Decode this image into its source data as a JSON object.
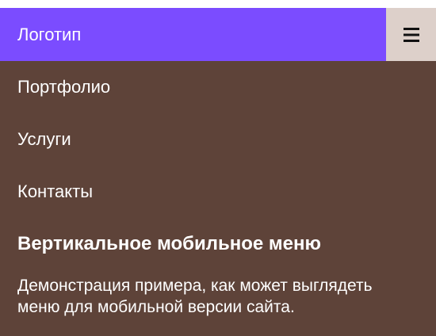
{
  "topnav": {
    "logo_label": "Логотип",
    "menu_icon": "hamburger-menu-icon",
    "logo_bg": "#7b4cff",
    "toggle_bg": "#ddd0ca",
    "menu_bg": "#5e4339"
  },
  "menu": {
    "items": [
      {
        "label": "Портфолио"
      },
      {
        "label": "Услуги"
      },
      {
        "label": "Контакты"
      }
    ]
  },
  "content": {
    "heading": "Вертикальное мобильное меню",
    "description": "Демонстрация примера, как может выглядеть меню для мобильной версии сайта."
  }
}
